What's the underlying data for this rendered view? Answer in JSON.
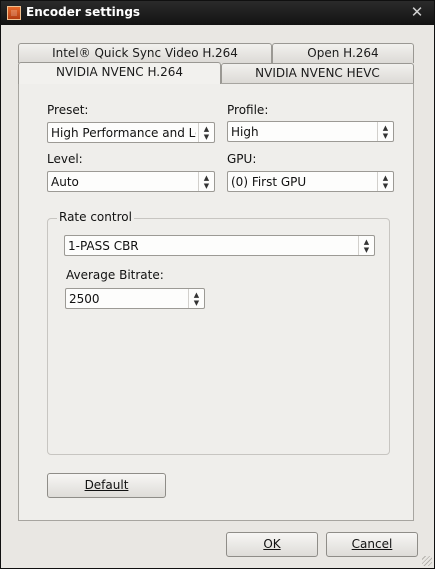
{
  "window": {
    "title": "Encoder settings"
  },
  "tabs": {
    "back_row": [
      {
        "label": "Intel® Quick Sync Video H.264"
      },
      {
        "label": "Open H.264"
      }
    ],
    "front_row": [
      {
        "label": "NVIDIA NVENC H.264",
        "active": true
      },
      {
        "label": "NVIDIA NVENC HEVC",
        "active": false
      }
    ]
  },
  "form": {
    "preset": {
      "label": "Preset:",
      "value": "High Performance and Low"
    },
    "profile": {
      "label": "Profile:",
      "value": "High"
    },
    "level": {
      "label": "Level:",
      "value": "Auto"
    },
    "gpu": {
      "label": "GPU:",
      "value": "(0) First GPU"
    }
  },
  "rate_control": {
    "title": "Rate control",
    "mode": "1-PASS CBR",
    "bitrate_label": "Average Bitrate:",
    "bitrate_value": "2500"
  },
  "buttons": {
    "default_label": "Default",
    "ok_label": "OK",
    "cancel_label": "Cancel"
  },
  "colors": {
    "titlebar": "#1a1a1a",
    "dialog_bg": "#e9e7e3",
    "panel_bg": "#efeeeb"
  }
}
